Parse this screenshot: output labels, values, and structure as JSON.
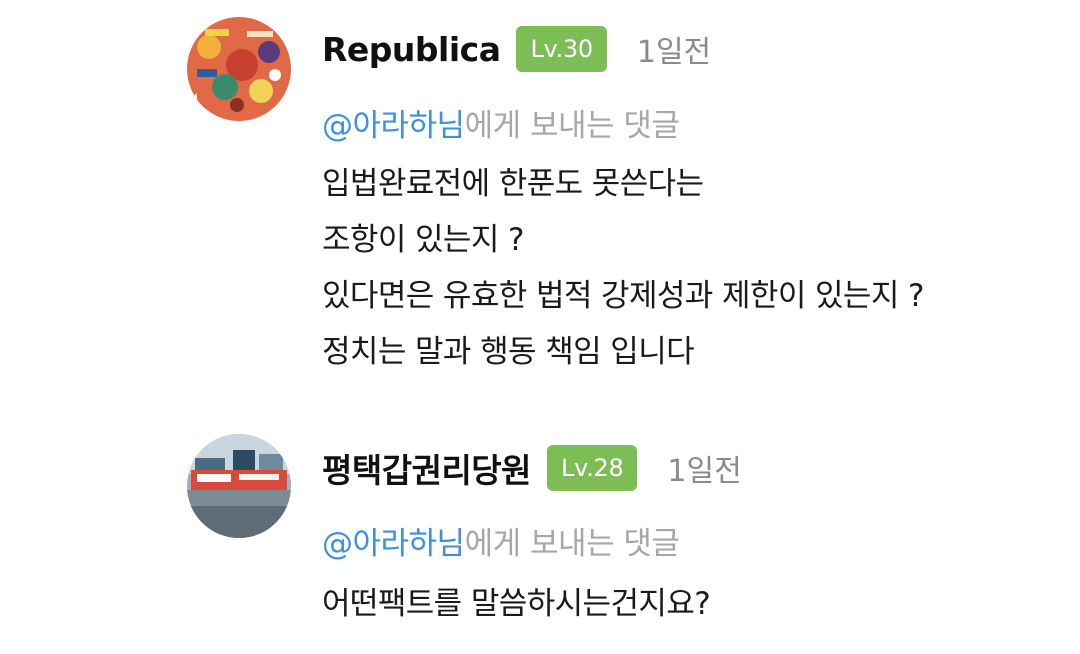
{
  "comments": [
    {
      "username": "Republica",
      "level": "Lv.30",
      "time": "1일전",
      "reply_mention": "@아라하님",
      "reply_suffix": "에게 보내는 댓글",
      "body": [
        "입법완료전에 한푼도 못쓴다는",
        "조항이 있는지 ?",
        "있다면은 유효한 법적 강제성과 제한이 있는지 ?",
        "정치는 말과 행동 책임 입니다"
      ]
    },
    {
      "username": "평택갑권리당원",
      "level": "Lv.28",
      "time": "1일전",
      "reply_mention": "@아라하님",
      "reply_suffix": "에게 보내는 댓글",
      "body": [
        "어떤팩트를 말씀하시는건지요?"
      ]
    }
  ],
  "colors": {
    "level_badge": "#7cbd56",
    "mention": "#3f8fdc",
    "muted_text": "#a7a7a7"
  }
}
